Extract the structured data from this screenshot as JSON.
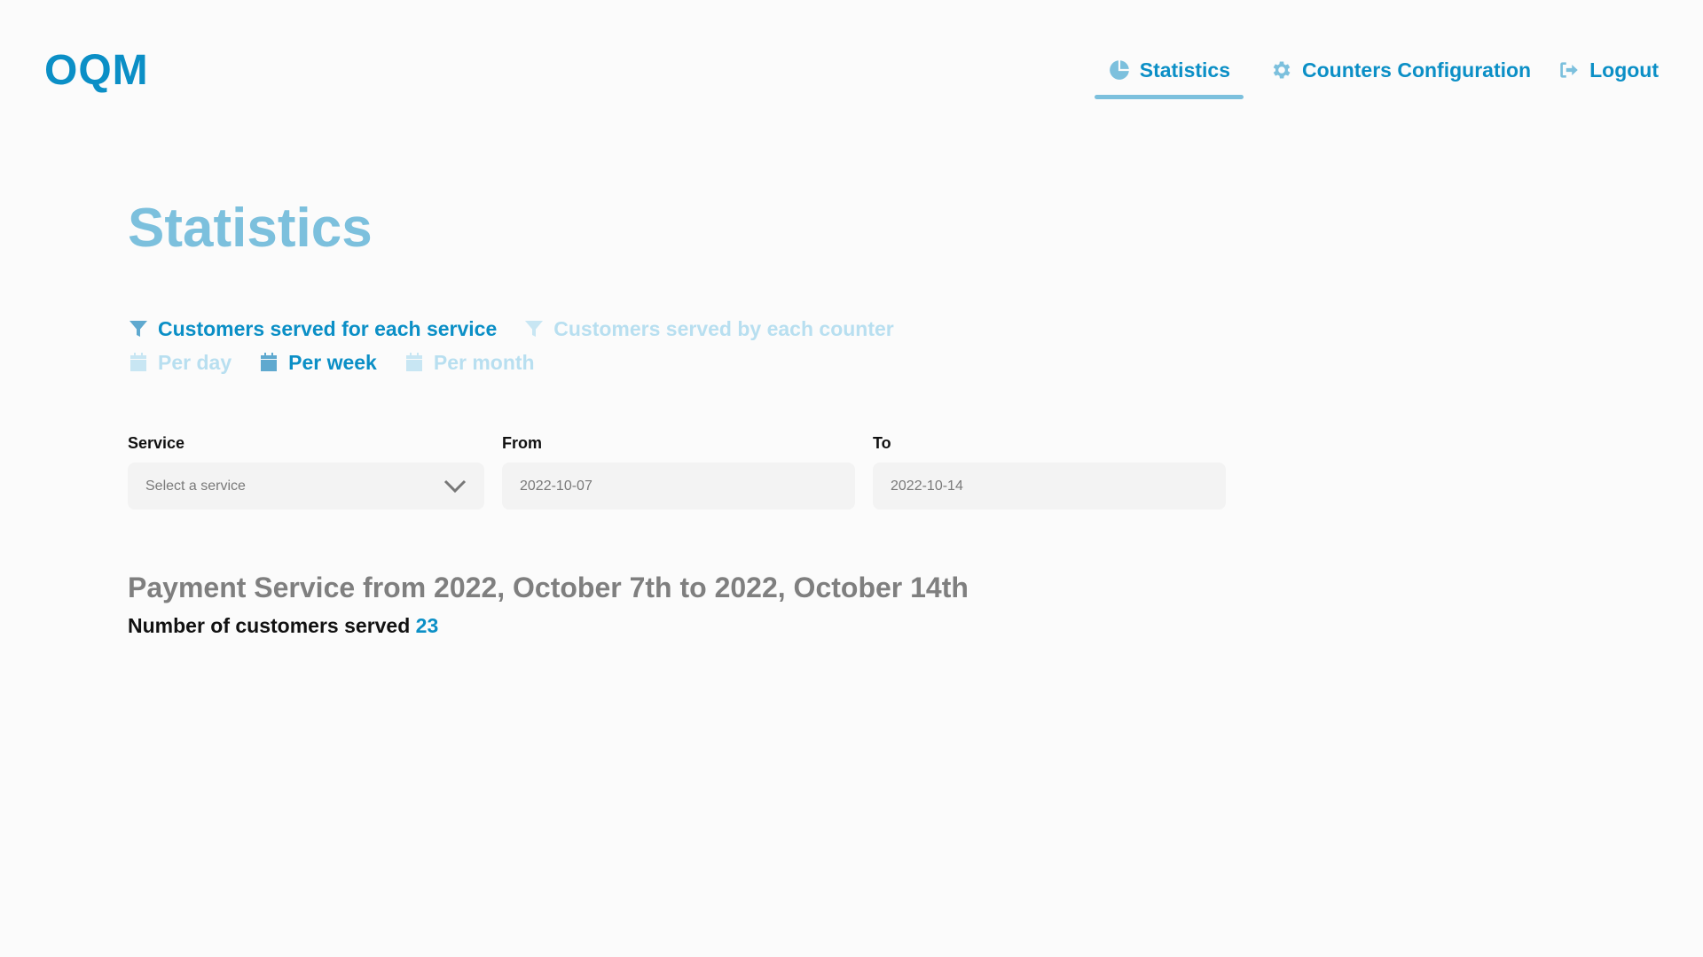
{
  "header": {
    "logo": "OQM",
    "nav": [
      {
        "label": "Statistics",
        "icon": "pie-chart-icon",
        "active": true
      },
      {
        "label": "Counters Configuration",
        "icon": "gear-icon",
        "active": false
      },
      {
        "label": "Logout",
        "icon": "logout-icon",
        "active": false
      }
    ]
  },
  "main": {
    "title": "Statistics",
    "filters": {
      "type": [
        {
          "label": "Customers served for each service",
          "icon": "filter-icon",
          "selected": true
        },
        {
          "label": "Customers served by each counter",
          "icon": "filter-icon",
          "selected": false
        }
      ],
      "period": [
        {
          "label": "Per day",
          "icon": "calendar-icon",
          "selected": false
        },
        {
          "label": "Per week",
          "icon": "calendar-icon",
          "selected": true
        },
        {
          "label": "Per month",
          "icon": "calendar-icon",
          "selected": false
        }
      ]
    },
    "form": {
      "service_label": "Service",
      "service_placeholder": "Select a service",
      "from_label": "From",
      "from_value": "2022-10-07",
      "to_label": "To",
      "to_value": "2022-10-14"
    },
    "result": {
      "title": "Payment Service from 2022, October 7th to 2022, October 14th",
      "count_label": "Number of customers served",
      "count_value": "23"
    }
  },
  "colors": {
    "primary": "#0b8fc6",
    "light_blue": "#7cc0dd",
    "inactive": "#b8dff0",
    "background": "#fbfbfb",
    "input_bg": "#f3f3f3"
  }
}
